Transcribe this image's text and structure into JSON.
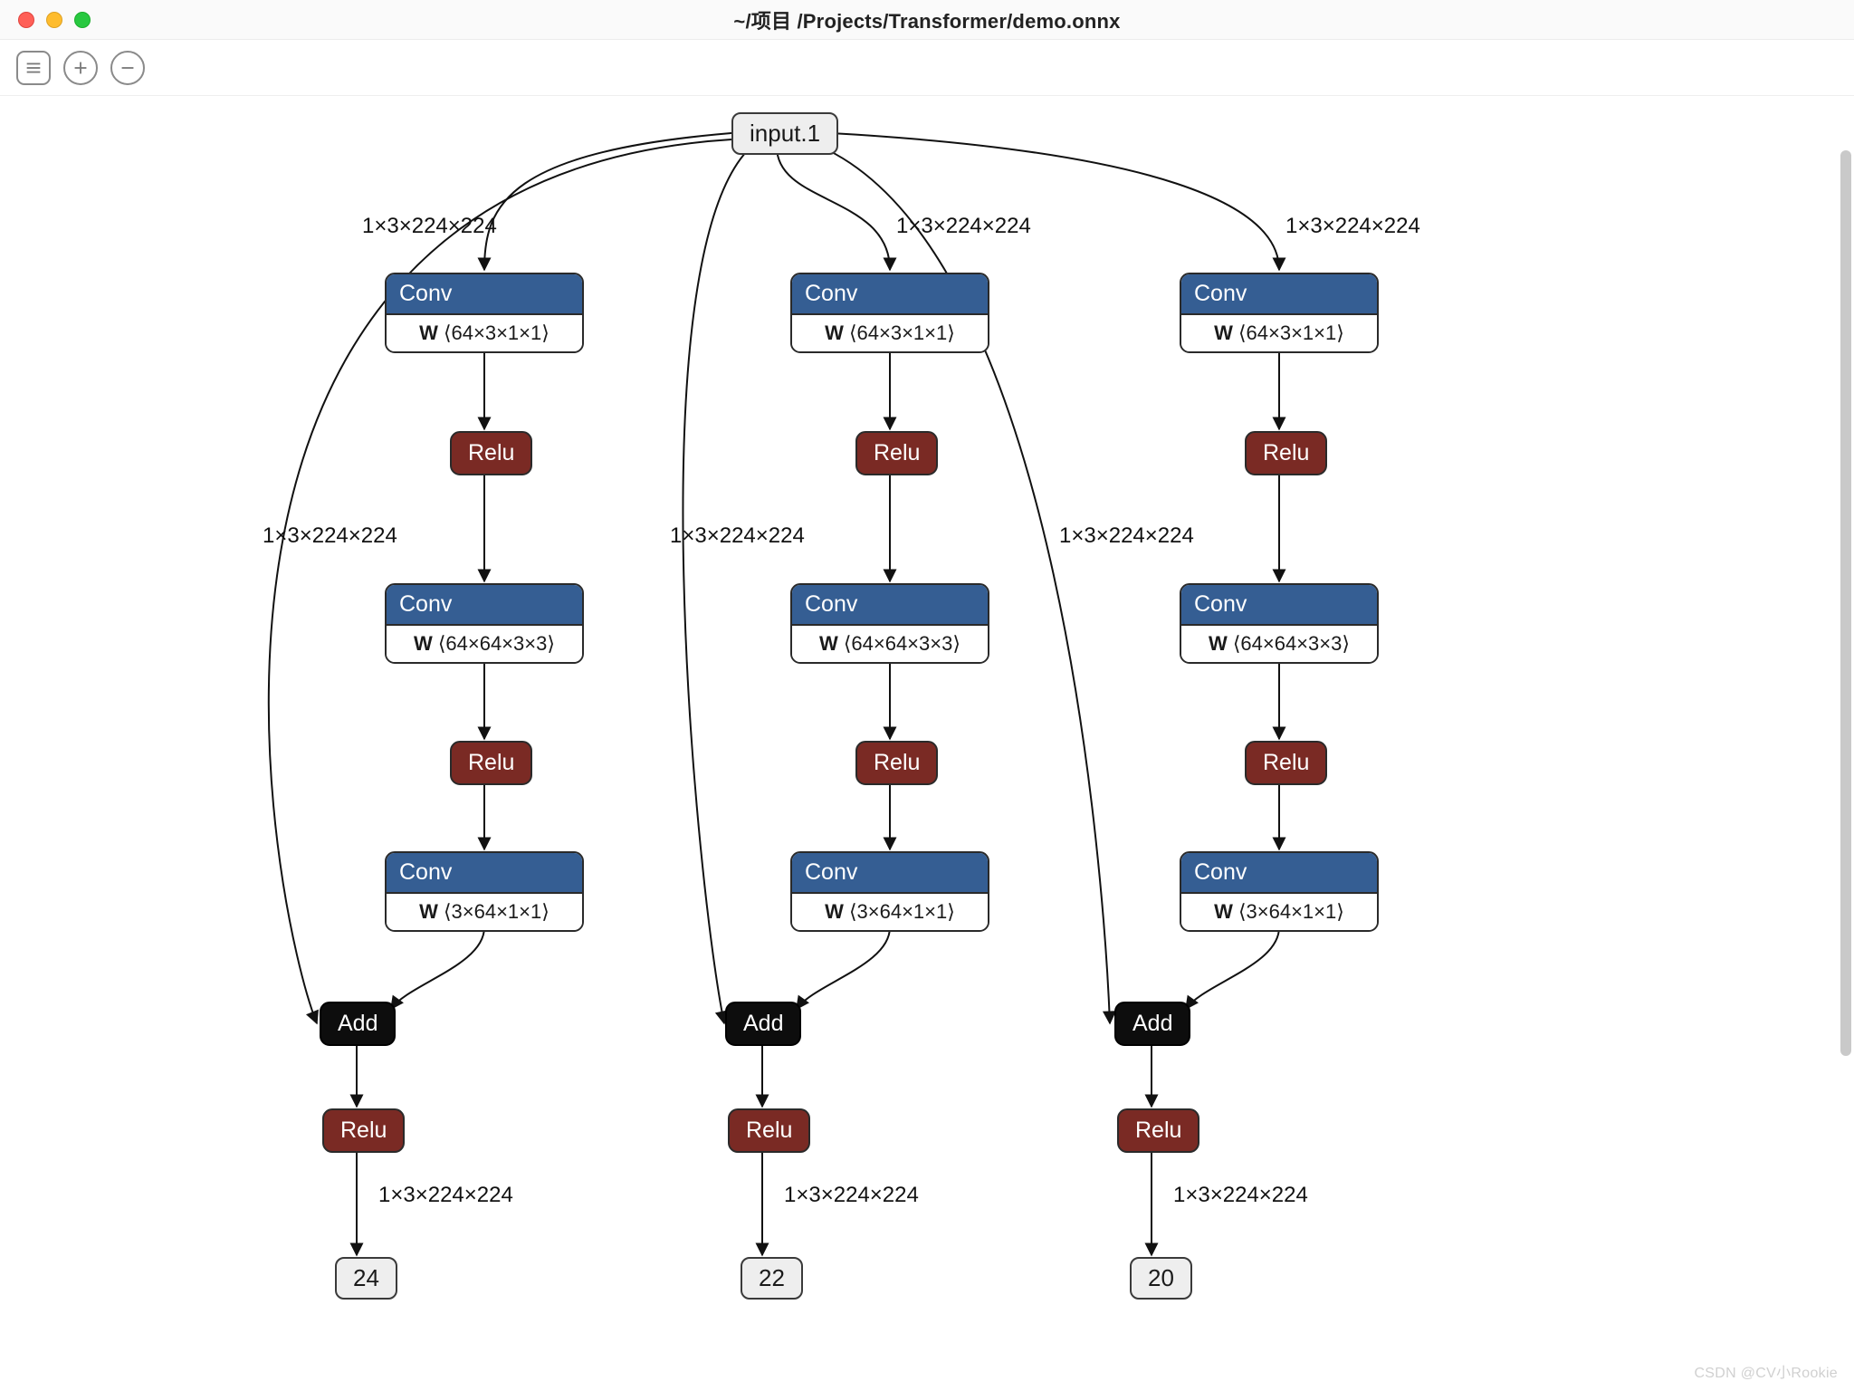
{
  "window": {
    "title": "~/项目 /Projects/Transformer/demo.onnx"
  },
  "toolbar": {
    "menu_name": "menu",
    "zoom_in_name": "zoom-in",
    "zoom_out_name": "zoom-out"
  },
  "graph": {
    "input": {
      "label": "input.1"
    },
    "edge_label": "1×3×224×224",
    "conv_label": "Conv",
    "relu_label": "Relu",
    "add_label": "Add",
    "w_label": "W",
    "conv_shapes": {
      "c1": "⟨64×3×1×1⟩",
      "c2": "⟨64×64×3×3⟩",
      "c3": "⟨3×64×1×1⟩"
    },
    "outputs": [
      "24",
      "22",
      "20"
    ]
  },
  "watermark": "CSDN @CV小Rookie"
}
